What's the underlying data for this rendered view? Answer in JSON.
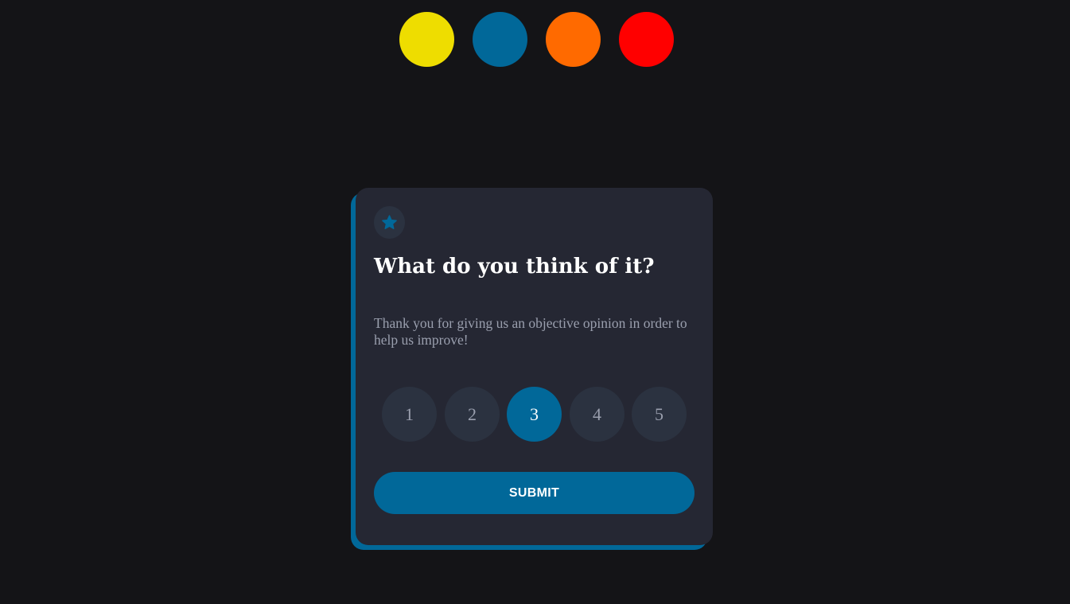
{
  "theme_swatches": [
    {
      "name": "yellow",
      "color": "#eedd00"
    },
    {
      "name": "blue",
      "color": "#016899"
    },
    {
      "name": "orange",
      "color": "#ff6a00"
    },
    {
      "name": "red",
      "color": "#ff0000"
    }
  ],
  "card": {
    "icon": "star-icon",
    "title": "What do you think of it?",
    "description": "Thank you for giving us an objective opinion in order to help us improve!",
    "ratings": [
      "1",
      "2",
      "3",
      "4",
      "5"
    ],
    "selected_rating": "3",
    "submit_label": "SUBMIT"
  },
  "colors": {
    "background": "#141417",
    "card": "#252733",
    "accent": "#016899",
    "muted_button": "#2b3240",
    "muted_text": "#9a9fae"
  }
}
